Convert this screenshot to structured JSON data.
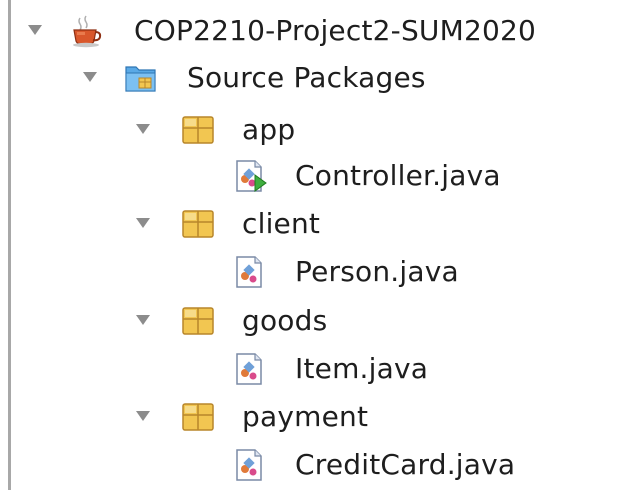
{
  "tree": {
    "project": {
      "label": "COP2210-Project2-SUM2020",
      "icon": "java-project-cup-icon",
      "expanded": true
    },
    "source_packages": {
      "label": "Source Packages",
      "icon": "source-packages-folder-icon",
      "expanded": true
    },
    "packages": [
      {
        "label": "app",
        "icon": "package-icon",
        "expanded": true,
        "files": [
          {
            "label": "Controller.java",
            "icon": "java-main-class-icon"
          }
        ]
      },
      {
        "label": "client",
        "icon": "package-icon",
        "expanded": true,
        "files": [
          {
            "label": "Person.java",
            "icon": "java-class-icon"
          }
        ]
      },
      {
        "label": "goods",
        "icon": "package-icon",
        "expanded": true,
        "files": [
          {
            "label": "Item.java",
            "icon": "java-class-icon"
          }
        ]
      },
      {
        "label": "payment",
        "icon": "package-icon",
        "expanded": true,
        "files": [
          {
            "label": "CreditCard.java",
            "icon": "java-class-icon"
          }
        ]
      }
    ]
  },
  "colors": {
    "text": "#1e1e1e",
    "expand_arrow": "#8c8c8c",
    "package_fill": "#f2c651",
    "package_stroke": "#b8862a",
    "folder_blue": "#5aa9e6"
  }
}
